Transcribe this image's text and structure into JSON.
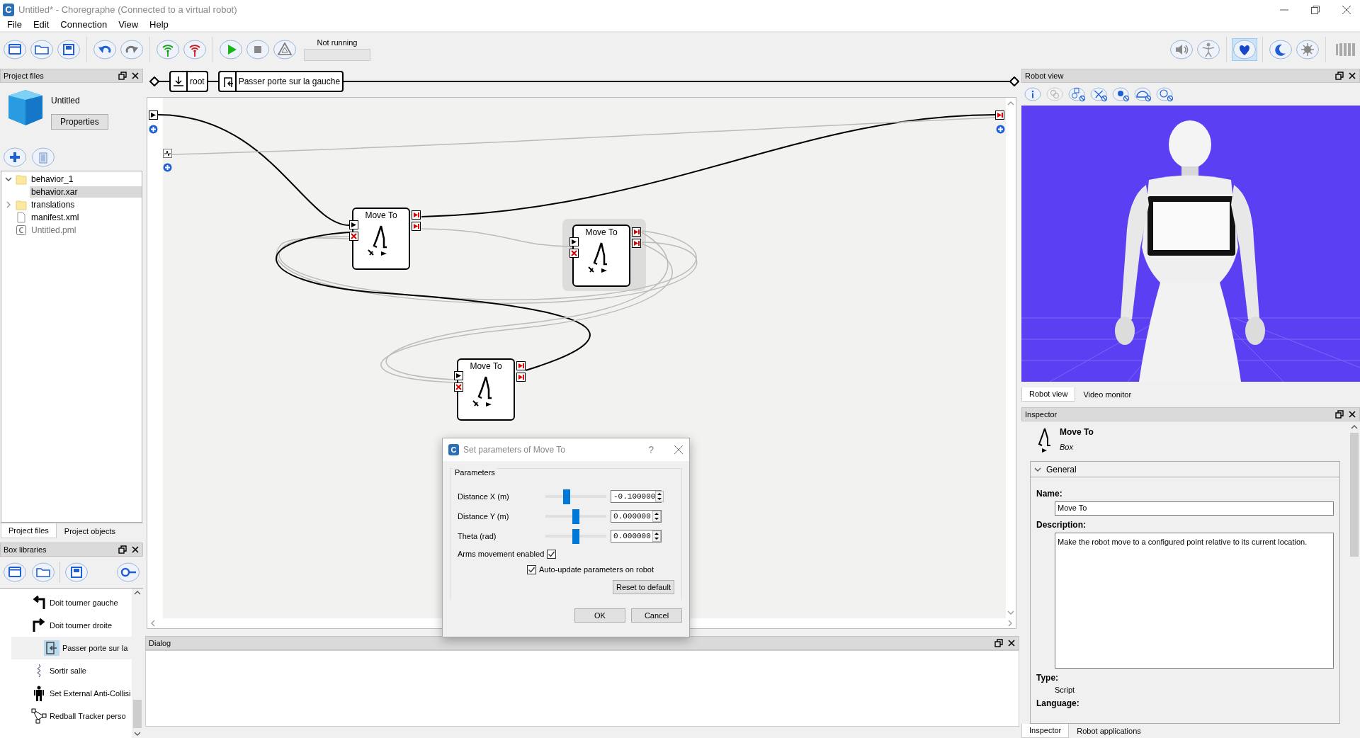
{
  "window": {
    "icon_text": "C",
    "title": "Untitled* - Choregraphe (Connected to a virtual robot)"
  },
  "menu": [
    "File",
    "Edit",
    "Connection",
    "View",
    "Help"
  ],
  "toolbar": {
    "run_status": "Not running",
    "progress": {
      "level": 0
    },
    "status_buttons": [
      {
        "kind": "volume",
        "selected": false
      },
      {
        "kind": "figure",
        "selected": false
      },
      {
        "kind": "heart",
        "selected": true
      },
      {
        "kind": "moon",
        "selected": false
      },
      {
        "kind": "sun",
        "selected": false
      }
    ]
  },
  "project_files": {
    "title": "Project files",
    "project_name": "Untitled",
    "properties_button": "Properties",
    "tree": [
      {
        "label": "behavior_1",
        "kind": "folder",
        "expanded": true,
        "selected": false,
        "children": [
          {
            "label": "behavior.xar",
            "selected": true
          }
        ]
      },
      {
        "label": "translations",
        "kind": "folder",
        "expanded": false,
        "selected": false
      },
      {
        "label": "manifest.xml",
        "kind": "file",
        "selected": false
      },
      {
        "label": "Untitled.pml",
        "kind": "pml",
        "selected": false
      }
    ],
    "tabs": [
      {
        "label": "Project files",
        "selected": true
      },
      {
        "label": "Project objects",
        "selected": false
      }
    ]
  },
  "box_libraries": {
    "title": "Box libraries",
    "items": [
      {
        "label": "Doit tourner gauche",
        "kind": "turn-left",
        "selected": false
      },
      {
        "label": "Doit tourner droite",
        "kind": "turn-right",
        "selected": false
      },
      {
        "label": "Passer porte sur la",
        "kind": "door",
        "selected": true
      },
      {
        "label": "Sortir salle",
        "kind": "squiggle",
        "selected": false
      },
      {
        "label": "Set External Anti-Collisi",
        "kind": "robot",
        "selected": false
      },
      {
        "label": "Redball Tracker perso",
        "kind": "graph",
        "selected": false
      }
    ]
  },
  "breadcrumb": [
    {
      "label": "root",
      "kind": "root"
    },
    {
      "label": "Passer porte sur la gauche",
      "kind": "door"
    }
  ],
  "canvas": {
    "boxes": [
      {
        "title": "Move To",
        "highlighted": false
      },
      {
        "title": "Move To",
        "highlighted": true
      },
      {
        "title": "Move To",
        "highlighted": false
      }
    ]
  },
  "dialog_panel": {
    "title": "Dialog"
  },
  "robot_view": {
    "title": "Robot view",
    "tabs": [
      {
        "label": "Robot view",
        "selected": true
      },
      {
        "label": "Video monitor",
        "selected": false
      }
    ]
  },
  "inspector": {
    "title": "Inspector",
    "box_name": "Move To",
    "box_type": "Box",
    "section": {
      "label": "General",
      "expanded": true
    },
    "fields": [
      {
        "label": "Name:",
        "kind": "input",
        "value": "Move To"
      },
      {
        "label": "Description:",
        "kind": "textarea",
        "value": "Make the robot move to a configured point relative to its current location."
      },
      {
        "label": "Type:",
        "kind": "text",
        "value": "Script"
      },
      {
        "label": "Language:"
      }
    ],
    "tabs": [
      {
        "label": "Inspector",
        "selected": true
      },
      {
        "label": "Robot applications",
        "selected": false
      }
    ]
  },
  "parameters_dialog": {
    "icon_text": "C",
    "title": "Set parameters of Move To",
    "help": "?",
    "group": "Parameters",
    "sliders": [
      {
        "label": "Distance X (m)",
        "level": 0.33,
        "value": "-0.100000"
      },
      {
        "label": "Distance Y (m)",
        "level": 0.5,
        "value": "0.000000"
      },
      {
        "label": "Theta (rad)",
        "level": 0.5,
        "value": "0.000000"
      }
    ],
    "checkboxes": [
      {
        "label": "Arms movement enabled",
        "checked": true,
        "kind": "label-first"
      },
      {
        "label": "Auto-update parameters on robot",
        "checked": true,
        "kind": "box-first"
      }
    ],
    "reset_button": "Reset to default",
    "ok_button": "OK",
    "cancel_button": "Cancel"
  }
}
